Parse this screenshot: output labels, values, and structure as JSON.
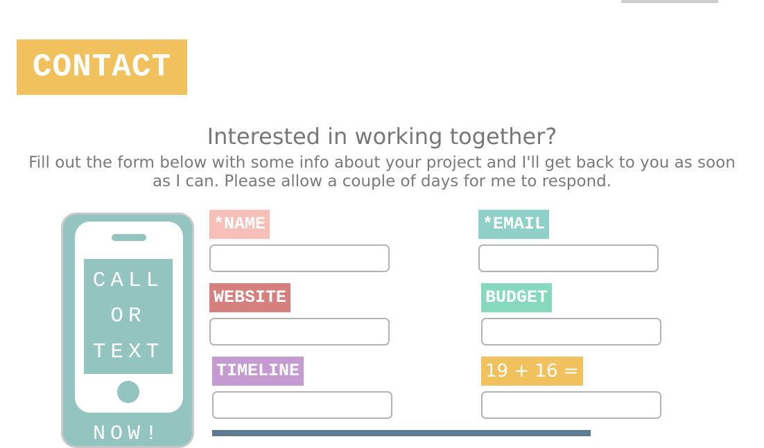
{
  "header": {
    "title": "CONTACT"
  },
  "intro": {
    "heading": "Interested in working together?",
    "subtext": "Fill out the form below with some info about your project and I'll get back to you as soon as I can. Please allow a couple of days for me to respond."
  },
  "phone": {
    "line1": "CALL",
    "line2": "OR",
    "line3": "TEXT",
    "line4": "NOW!"
  },
  "form": {
    "name_label": "*NAME",
    "email_label": "*EMAIL",
    "website_label": "WEBSITE",
    "budget_label": "BUDGET",
    "timeline_label": "TIMELINE",
    "captcha_label": "19 + 16 =",
    "name_value": "",
    "email_value": "",
    "website_value": "",
    "budget_value": "",
    "timeline_value": "",
    "captcha_value": ""
  },
  "colors": {
    "banner": "#f0c15c",
    "name": "#f6bfb8",
    "email": "#8fd1c9",
    "website": "#d67f7f",
    "budget": "#86d9bd",
    "timeline": "#c39bd0",
    "captcha": "#f0c15c",
    "phone": "#93c4c0",
    "submit": "#5e7a93"
  },
  "icons": {
    "phone": "phone-icon"
  }
}
